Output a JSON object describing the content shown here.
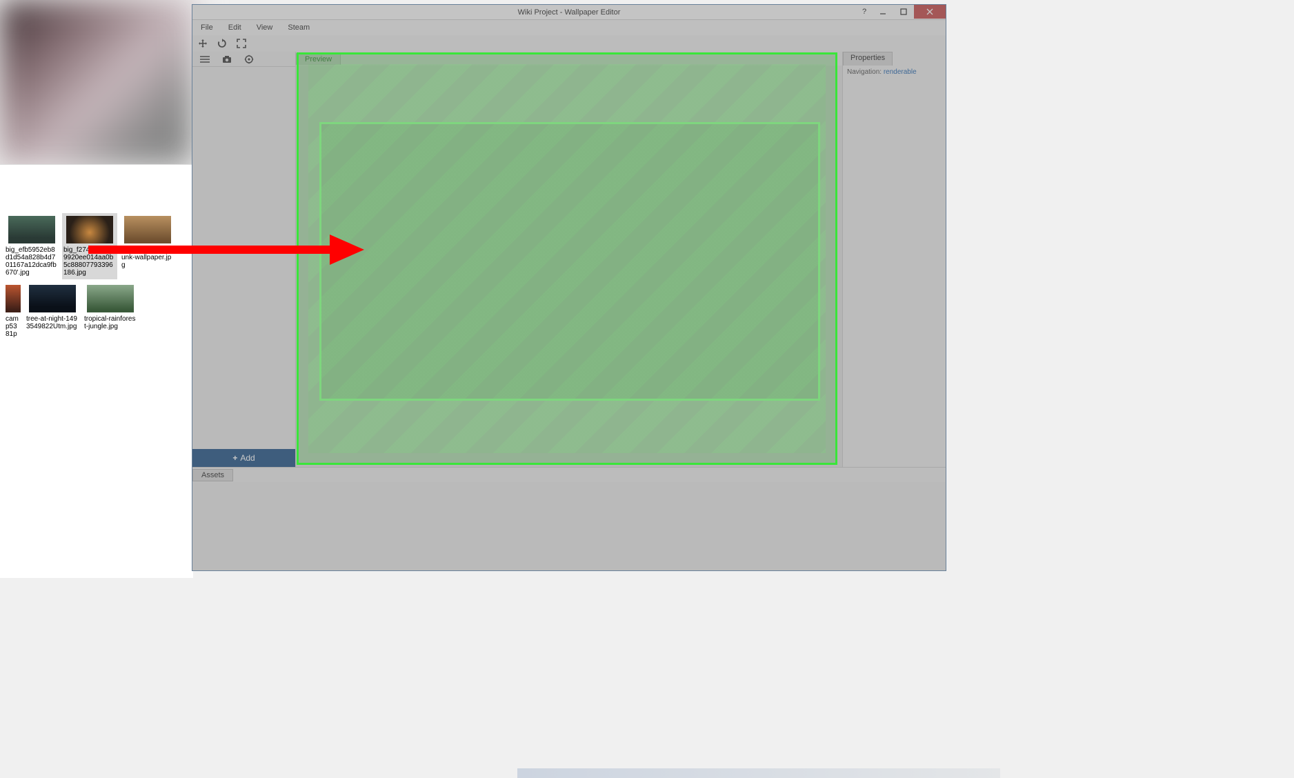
{
  "window": {
    "title": "Wiki Project - Wallpaper Editor"
  },
  "menu": {
    "file": "File",
    "edit": "Edit",
    "view": "View",
    "steam": "Steam"
  },
  "left_panel": {
    "add_label": "Add"
  },
  "preview": {
    "tab_label": "Preview"
  },
  "properties": {
    "tab_label": "Properties",
    "nav_label": "Navigation:",
    "nav_link": "renderable"
  },
  "assets": {
    "tab_label": "Assets"
  },
  "files": [
    {
      "name": "big_efb5952eb8d1d54a828b4d701167a12dca9fb670'.jpg"
    },
    {
      "name": "big_f274b3929f09920ee014aa0b5c88807793396186.jpg"
    },
    {
      "name": "buldozer-steampunk-wallpaper.jpg"
    },
    {
      "name": "camp5381p"
    },
    {
      "name": "tree-at-night-1493549822Utm.jpg"
    },
    {
      "name": "tropical-rainforest-jungle.jpg"
    }
  ]
}
